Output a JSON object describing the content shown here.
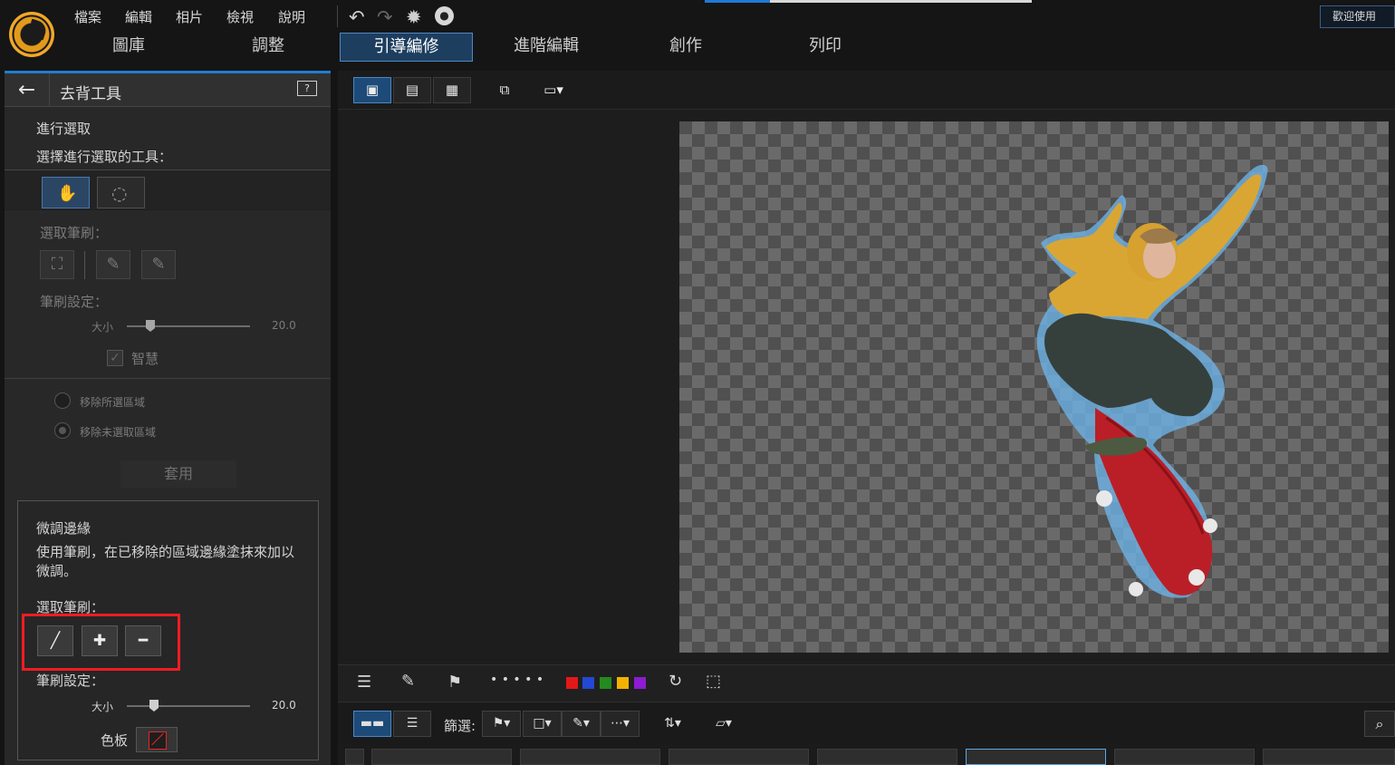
{
  "menu": [
    "檔案",
    "編輯",
    "相片",
    "檢視",
    "說明"
  ],
  "welcome": "歡迎使用",
  "tabs": [
    "圖庫",
    "調整",
    "引導編修",
    "進階編輯",
    "創作",
    "列印"
  ],
  "panel": {
    "title": "去背工具",
    "section_title": "進行選取",
    "section_subtitle": "選擇進行選取的工具：",
    "select_brush_label": "選取筆刷：",
    "brush_settings_label": "筆刷設定：",
    "size_label": "大小",
    "size_value": "20.0",
    "smart_label": "智慧",
    "remove_selected": "移除所選區域",
    "remove_unselected": "移除未選取區域",
    "apply_label": "套用"
  },
  "refine": {
    "title": "微調邊緣",
    "description": "使用筆刷，在已移除的區域邊緣塗抹來加以微調。",
    "select_brush_label": "選取筆刷：",
    "brush_settings_label": "筆刷設定：",
    "size_label": "大小",
    "size_value": "20.0",
    "palette_label": "色板"
  },
  "filter": {
    "label": "篩選:"
  },
  "colors": {
    "accent": "#1e7fd1",
    "highlight_red": "#ef1d22",
    "swatches": [
      "#e31818",
      "#2448d4",
      "#238b1f",
      "#f2b300",
      "#8d1bd1"
    ]
  },
  "icons": [
    "app-logo-icon",
    "undo-icon",
    "redo-icon",
    "settings-icon",
    "notification-icon",
    "back-arrow-icon",
    "help-icon",
    "smart-brush-icon",
    "lasso-icon",
    "brush-add-icon",
    "brush-subtract-icon",
    "color-palette-icon",
    "search-icon"
  ]
}
